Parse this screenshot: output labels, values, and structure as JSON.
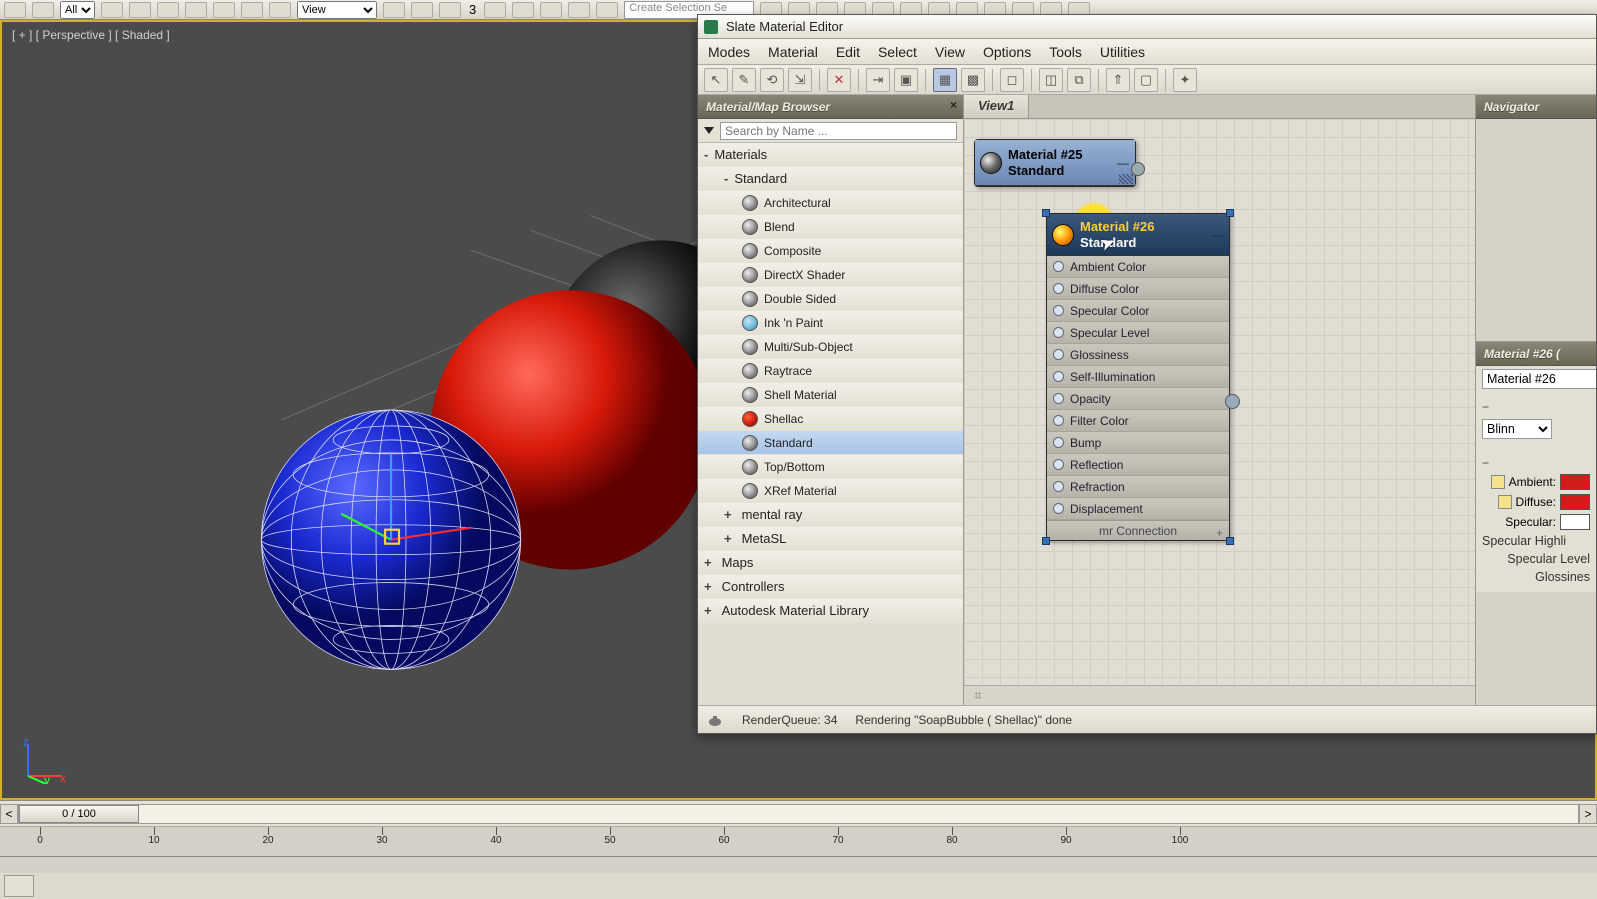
{
  "main_toolbar": {
    "dropdown_all": "All",
    "dropdown_view": "View",
    "three_label": "3",
    "selset_placeholder": "Create Selection Se"
  },
  "viewport": {
    "label": "[ + ] [ Perspective ] [ Shaded ]"
  },
  "time": {
    "pos": "0 / 100",
    "ticks": [
      0,
      10,
      20,
      30,
      40,
      50,
      60,
      70,
      80,
      90,
      100
    ]
  },
  "slate": {
    "title": "Slate Material Editor",
    "menus": [
      "Modes",
      "Material",
      "Edit",
      "Select",
      "View",
      "Options",
      "Tools",
      "Utilities"
    ],
    "status_left": "RenderQueue: 34",
    "status_right": "Rendering \"SoapBubble ( Shellac)\" done"
  },
  "browser": {
    "title": "Material/Map Browser",
    "search_placeholder": "Search by Name ...",
    "groups": {
      "materials": "Materials",
      "standard": "Standard",
      "items": [
        "Architectural",
        "Blend",
        "Composite",
        "DirectX Shader",
        "Double Sided",
        "Ink 'n Paint",
        "Multi/Sub-Object",
        "Raytrace",
        "Shell Material",
        "Shellac",
        "Standard",
        "Top/Bottom",
        "XRef Material"
      ],
      "mental_ray": "mental ray",
      "metasl": "MetaSL",
      "maps": "Maps",
      "controllers": "Controllers",
      "autodesk": "Autodesk Material Library"
    }
  },
  "nodeview": {
    "tab": "View1",
    "bottom_icon": "zoom-extents-icon"
  },
  "nodes": {
    "n25": {
      "title": "Material #25",
      "sub": "Standard"
    },
    "n26": {
      "title": "Material #26",
      "sub": "Standard",
      "slots": [
        "Ambient Color",
        "Diffuse Color",
        "Specular Color",
        "Specular Level",
        "Glossiness",
        "Self-Illumination",
        "Opacity",
        "Filter Color",
        "Bump",
        "Reflection",
        "Refraction",
        "Displacement"
      ],
      "footer": "mr Connection"
    }
  },
  "navigator": {
    "title": "Navigator"
  },
  "props": {
    "header": "Material #26  (",
    "name": "Material #26",
    "shader": "Blinn",
    "labels": {
      "ambient": "Ambient:",
      "diffuse": "Diffuse:",
      "specular": "Specular:"
    },
    "groups": {
      "highlights": "Specular Highli",
      "level": "Specular Level",
      "gloss": "Glossines"
    },
    "colors": {
      "ambient": "#d41c1c",
      "diffuse": "#d41c1c",
      "specular": "#ffffff"
    }
  }
}
